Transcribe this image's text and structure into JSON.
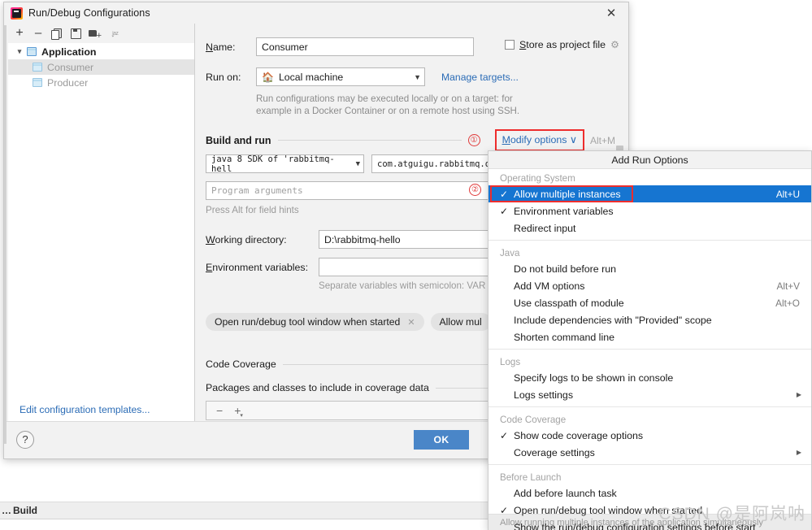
{
  "window": {
    "title": "Run/Debug Configurations",
    "app_icon": "intellij-idea-icon",
    "close_label": "✕"
  },
  "left_panel": {
    "toolbar": [
      {
        "name": "add-configuration-button",
        "icon": "plus-icon"
      },
      {
        "name": "remove-configuration-button",
        "icon": "minus-icon"
      },
      {
        "name": "copy-configuration-button",
        "icon": "copy-icon"
      },
      {
        "name": "save-configuration-button",
        "icon": "save-icon"
      },
      {
        "name": "move-into-folder-button",
        "icon": "folder-add-icon"
      },
      {
        "name": "sort-configurations-button",
        "icon": "sort-alpha-icon"
      }
    ],
    "tree": [
      {
        "label": "Application",
        "type": "group",
        "expanded": true,
        "selected": false
      },
      {
        "label": "Consumer",
        "type": "child",
        "selected": true
      },
      {
        "label": "Producer",
        "type": "child",
        "selected": false
      }
    ],
    "edit_templates_link": "Edit configuration templates..."
  },
  "form": {
    "name_label": "Name:",
    "name_value": "Consumer",
    "store_as_project_file_label": "Store as project file",
    "store_as_project_file_checked": false,
    "store_gear_icon": "gear-icon",
    "run_on_label": "Run on:",
    "run_on_value": "Local machine",
    "run_on_icon": "home-icon",
    "manage_targets_link": "Manage targets...",
    "run_on_hint_line1": "Run configurations may be executed locally or on a target: for",
    "run_on_hint_line2": "example in a Docker Container or on a remote host using SSH.",
    "build_and_run_title": "Build and run",
    "marker_one": "①",
    "marker_two": "②",
    "modify_options_label": "Modify options",
    "modify_options_caret": "∨",
    "modify_options_shortcut": "Alt+M",
    "jdk_value": "java 8 SDK of 'rabbitmq-hell",
    "module_value": "com.atguigu.rabbitmq.one.",
    "program_arguments_placeholder": "Program arguments",
    "field_hints_text": "Press Alt for field hints",
    "working_directory_label": "Working directory:",
    "working_directory_value": "D:\\rabbitmq-hello",
    "environment_variables_label": "Environment variables:",
    "environment_variables_value": "",
    "environment_hint": "Separate variables with semicolon: VAR",
    "chips": [
      {
        "label": "Open run/debug tool window when started",
        "removable": true
      },
      {
        "label": "Allow mul",
        "removable": false
      }
    ],
    "code_coverage_title": "Code Coverage",
    "packages_title": "Packages and classes to include in coverage data",
    "coverage_toolbar": [
      {
        "name": "remove-package-button",
        "icon": "minus-icon"
      },
      {
        "name": "add-package-button",
        "icon": "plus-dropdown-icon"
      }
    ]
  },
  "footer": {
    "help_label": "?",
    "ok_label": "OK"
  },
  "popup": {
    "header": "Add Run Options",
    "footer_hint": "Allow running multiple instances of the application simultaneously",
    "groups": [
      {
        "label": "Operating System",
        "items": [
          {
            "label": "Allow multiple instances",
            "checked": true,
            "accel": "Alt+U",
            "highlighted": true,
            "boxed": true
          },
          {
            "label": "Environment variables",
            "checked": true,
            "accel": "",
            "highlighted": false,
            "boxed": false
          },
          {
            "label": "Redirect input",
            "checked": false,
            "accel": "",
            "highlighted": false,
            "boxed": false
          }
        ]
      },
      {
        "label": "Java",
        "items": [
          {
            "label": "Do not build before run",
            "checked": false,
            "accel": "",
            "highlighted": false,
            "boxed": false
          },
          {
            "label": "Add VM options",
            "checked": false,
            "accel": "Alt+V",
            "highlighted": false,
            "boxed": false
          },
          {
            "label": "Use classpath of module",
            "checked": false,
            "accel": "Alt+O",
            "highlighted": false,
            "boxed": false
          },
          {
            "label": "Include dependencies with \"Provided\" scope",
            "checked": false,
            "accel": "",
            "highlighted": false,
            "boxed": false
          },
          {
            "label": "Shorten command line",
            "checked": false,
            "accel": "",
            "highlighted": false,
            "boxed": false
          }
        ]
      },
      {
        "label": "Logs",
        "items": [
          {
            "label": "Specify logs to be shown in console",
            "checked": false,
            "accel": "",
            "highlighted": false,
            "boxed": false
          },
          {
            "label": "Logs settings",
            "checked": false,
            "accel": "",
            "submenu": true,
            "highlighted": false,
            "boxed": false
          }
        ]
      },
      {
        "label": "Code Coverage",
        "items": [
          {
            "label": "Show code coverage options",
            "checked": true,
            "accel": "",
            "highlighted": false,
            "boxed": false
          },
          {
            "label": "Coverage settings",
            "checked": false,
            "accel": "",
            "submenu": true,
            "highlighted": false,
            "boxed": false
          }
        ]
      },
      {
        "label": "Before Launch",
        "items": [
          {
            "label": "Add before launch task",
            "checked": false,
            "accel": "",
            "highlighted": false,
            "boxed": false
          },
          {
            "label": "Open run/debug tool window when started",
            "checked": true,
            "accel": "",
            "highlighted": false,
            "boxed": false
          },
          {
            "label": "Show the run/debug configuration settings before start",
            "checked": false,
            "accel": "",
            "highlighted": false,
            "boxed": false
          }
        ]
      }
    ]
  },
  "background": {
    "build_status_text": "Build"
  },
  "watermark": "CSDN @是阿岚呐",
  "colors": {
    "accent_blue": "#1675d1",
    "link_blue": "#2b6cb6",
    "highlight_red": "#ee2d2d",
    "ok_button": "#4a86c8",
    "dialog_bg": "#f2f2f2"
  }
}
